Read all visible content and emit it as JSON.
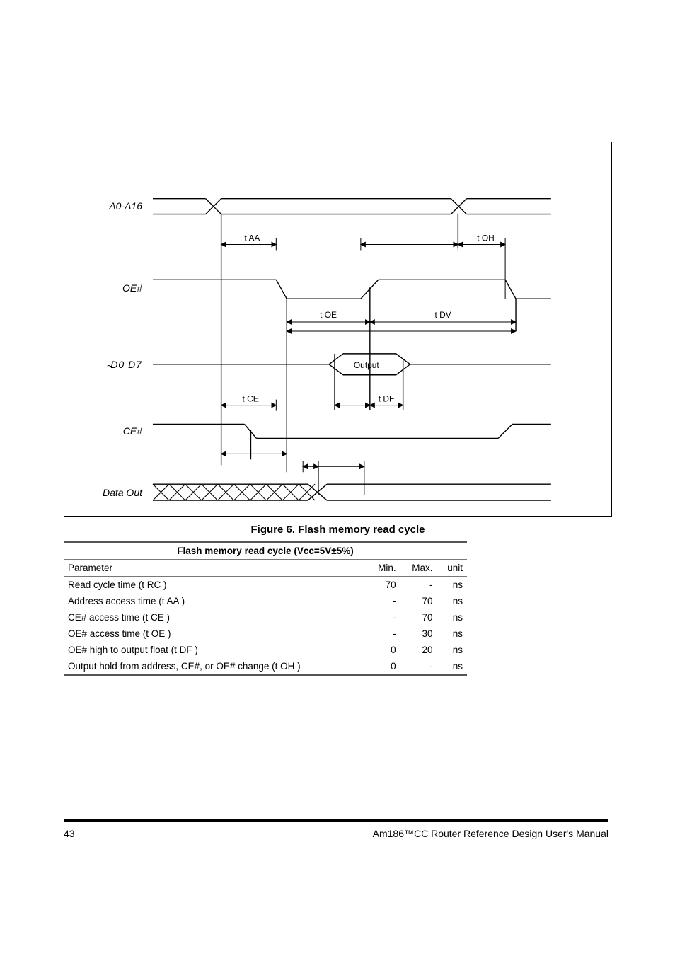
{
  "signals": {
    "addr": "A0-A16",
    "oe": "OE#",
    "data": "D0  D7",
    "ce": "CE#",
    "dout": "Data Out"
  },
  "timing_params": {
    "t_aa": "t AA",
    "t_oh": "t OH",
    "t_oe": "t OE",
    "t_dv": "t DV",
    "t_ce": "t CE",
    "t_df": "t DF"
  },
  "output_state": "Output",
  "caption": {
    "number": "Figure 6.",
    "title": "Flash memory read cycle"
  },
  "table": {
    "title": "Flash memory read cycle (Vcc=5V±5%)",
    "header": {
      "param": "Parameter",
      "min": "Min.",
      "max": "Max.",
      "unit": "unit"
    },
    "rows": [
      {
        "p": "Read cycle time (t RC )",
        "min": "70",
        "max": "-",
        "u": "ns"
      },
      {
        "p": "Address access time (t AA )",
        "min": "-",
        "max": "70",
        "u": "ns"
      },
      {
        "p": "CE# access time (t CE )",
        "min": "-",
        "max": "70",
        "u": "ns"
      },
      {
        "p": "OE# access time (t OE )",
        "min": "-",
        "max": "30",
        "u": "ns"
      },
      {
        "p": "OE# high to output float (t DF )",
        "min": "0",
        "max": "20",
        "u": "ns"
      },
      {
        "p": "Output hold from address, CE#, or OE# change (t OH )",
        "min": "0",
        "max": "-",
        "u": "ns"
      }
    ]
  },
  "footer": {
    "page": "43",
    "doc": "Am186™CC Router Reference Design User's Manual"
  }
}
